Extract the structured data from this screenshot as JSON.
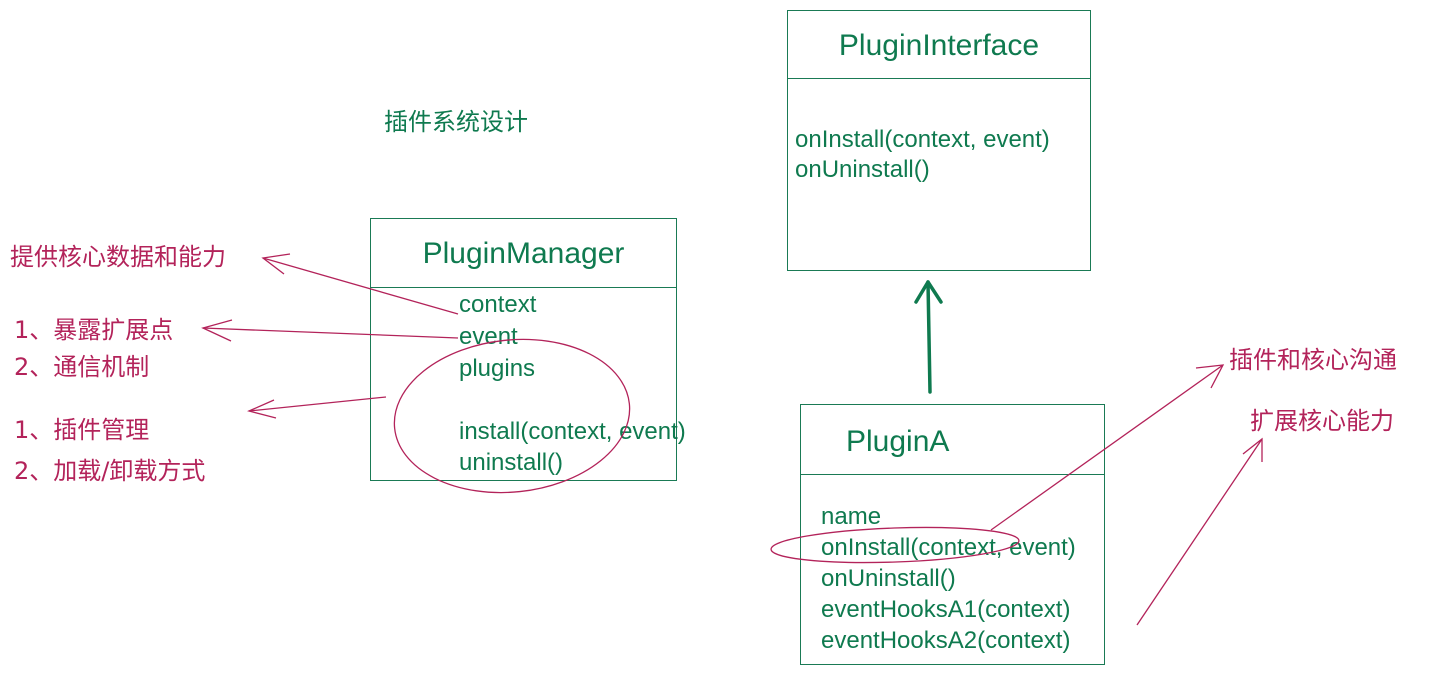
{
  "diagram_title": "插件系统设计",
  "plugin_interface": {
    "title": "PluginInterface",
    "methods": [
      "onInstall(context, event)",
      "onUninstall()"
    ]
  },
  "plugin_manager": {
    "title": "PluginManager",
    "members": [
      "context",
      "event",
      "plugins",
      "install(context, event)",
      "uninstall()"
    ]
  },
  "plugin_a": {
    "title": "PluginA",
    "members": [
      "name",
      "onInstall(context, event)",
      "onUninstall()",
      "eventHooksA1(context)",
      "eventHooksA2(context)"
    ]
  },
  "annotations": {
    "core_data": "提供核心数据和能力",
    "expose_1": "1、暴露扩展点",
    "expose_2": "2、通信机制",
    "manage_1": "1、插件管理",
    "manage_2": "2、加载/卸载方式",
    "communicate": "插件和核心沟通",
    "extend": "扩展核心能力"
  },
  "colors": {
    "box_stroke": "#1a7a55",
    "box_text": "#0f7a4f",
    "annotation": "#b3235a",
    "inherit_arrow": "#0f7a4f"
  }
}
